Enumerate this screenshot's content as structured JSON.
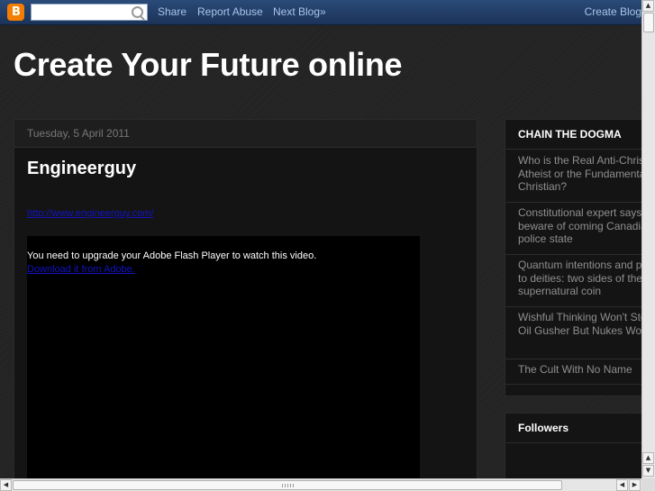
{
  "navbar": {
    "logo_letter": "B",
    "search_value": "",
    "share": "Share",
    "report_abuse": "Report Abuse",
    "next_blog": "Next Blog»",
    "create_blog": "Create Blog"
  },
  "header": {
    "title": "Create Your Future online"
  },
  "post": {
    "date": "Tuesday, 5 April 2011",
    "title": "Engineerguy",
    "link": "http://www.engineerguy.com/",
    "flash_message": "You need to upgrade your Adobe Flash Player to watch this video.",
    "flash_download": "Download it from Adobe."
  },
  "sidebar": {
    "chain_title": "CHAIN THE DOGMA",
    "feed_items": [
      "Who is the Real Anti-Christ: the Atheist or the Fundamentalist Christian?",
      "Constitutional expert says beware of coming Canadian police state",
      "Quantum intentions and prayers to deities: two sides of the same supernatural coin",
      "Wishful Thinking Won't Stop The Oil Gusher But Nukes Would",
      "The Cult With No Name"
    ],
    "followers_title": "Followers"
  },
  "scrollbars": {
    "up": "▲",
    "down": "▼",
    "left": "◀",
    "right": "▶"
  }
}
